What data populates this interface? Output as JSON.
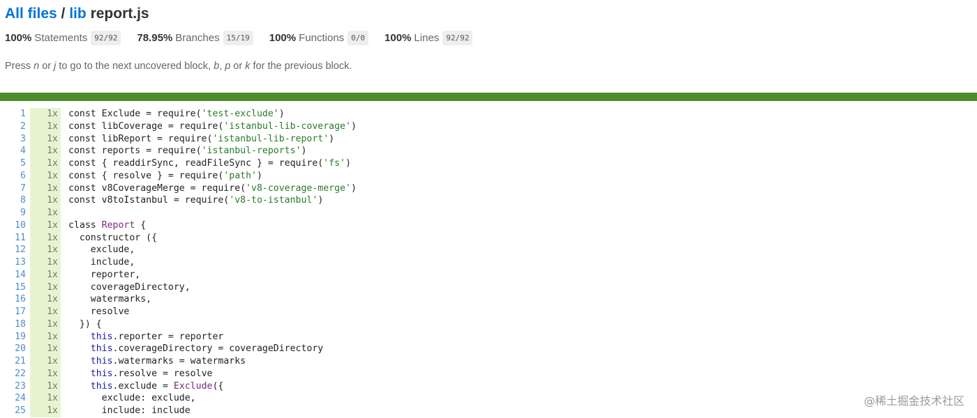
{
  "breadcrumb": {
    "all_files": "All files",
    "sep": " / ",
    "dir": "lib",
    "file": "report.js"
  },
  "summary": [
    {
      "pct": "100%",
      "label": "Statements",
      "frac": "92/92"
    },
    {
      "pct": "78.95%",
      "label": "Branches",
      "frac": "15/19"
    },
    {
      "pct": "100%",
      "label": "Functions",
      "frac": "0/0"
    },
    {
      "pct": "100%",
      "label": "Lines",
      "frac": "92/92"
    }
  ],
  "hint": {
    "p1": "Press ",
    "k1": "n",
    "p2": " or ",
    "k2": "j",
    "p3": " to go to the next uncovered block, ",
    "k3": "b",
    "p4": ", ",
    "k4": "p",
    "p5": " or ",
    "k5": "k",
    "p6": " for the previous block."
  },
  "status_color": "#4d8c2a",
  "lines": [
    {
      "n": "1",
      "hits": "1x",
      "code": [
        [
          "kw",
          "const "
        ],
        [
          "",
          "Exclude = require("
        ],
        [
          "str",
          "'test-exclude'"
        ],
        [
          "",
          ")"
        ]
      ]
    },
    {
      "n": "2",
      "hits": "1x",
      "code": [
        [
          "kw",
          "const "
        ],
        [
          "",
          "libCoverage = require("
        ],
        [
          "str",
          "'istanbul-lib-coverage'"
        ],
        [
          "",
          ")"
        ]
      ]
    },
    {
      "n": "3",
      "hits": "1x",
      "code": [
        [
          "kw",
          "const "
        ],
        [
          "",
          "libReport = require("
        ],
        [
          "str",
          "'istanbul-lib-report'"
        ],
        [
          "",
          ")"
        ]
      ]
    },
    {
      "n": "4",
      "hits": "1x",
      "code": [
        [
          "kw",
          "const "
        ],
        [
          "",
          "reports = require("
        ],
        [
          "str",
          "'istanbul-reports'"
        ],
        [
          "",
          ")"
        ]
      ]
    },
    {
      "n": "5",
      "hits": "1x",
      "code": [
        [
          "kw",
          "const "
        ],
        [
          "",
          "{ readdirSync, readFileSync } = require("
        ],
        [
          "str",
          "'fs'"
        ],
        [
          "",
          ")"
        ]
      ]
    },
    {
      "n": "6",
      "hits": "1x",
      "code": [
        [
          "kw",
          "const "
        ],
        [
          "",
          "{ resolve } = require("
        ],
        [
          "str",
          "'path'"
        ],
        [
          "",
          ")"
        ]
      ]
    },
    {
      "n": "7",
      "hits": "1x",
      "code": [
        [
          "kw",
          "const "
        ],
        [
          "",
          "v8CoverageMerge = require("
        ],
        [
          "str",
          "'v8-coverage-merge'"
        ],
        [
          "",
          ")"
        ]
      ]
    },
    {
      "n": "8",
      "hits": "1x",
      "code": [
        [
          "kw",
          "const "
        ],
        [
          "",
          "v8toIstanbul = require("
        ],
        [
          "str",
          "'v8-to-istanbul'"
        ],
        [
          "",
          ")"
        ]
      ]
    },
    {
      "n": "9",
      "hits": "1x",
      "code": []
    },
    {
      "n": "10",
      "hits": "1x",
      "code": [
        [
          "kw",
          "class "
        ],
        [
          "cls",
          "Report"
        ],
        [
          "",
          " {"
        ]
      ]
    },
    {
      "n": "11",
      "hits": "1x",
      "code": [
        [
          "",
          "  constructor ({"
        ]
      ]
    },
    {
      "n": "12",
      "hits": "1x",
      "code": [
        [
          "",
          "    exclude,"
        ]
      ]
    },
    {
      "n": "13",
      "hits": "1x",
      "code": [
        [
          "",
          "    include,"
        ]
      ]
    },
    {
      "n": "14",
      "hits": "1x",
      "code": [
        [
          "",
          "    reporter,"
        ]
      ]
    },
    {
      "n": "15",
      "hits": "1x",
      "code": [
        [
          "",
          "    coverageDirectory,"
        ]
      ]
    },
    {
      "n": "16",
      "hits": "1x",
      "code": [
        [
          "",
          "    watermarks,"
        ]
      ]
    },
    {
      "n": "17",
      "hits": "1x",
      "code": [
        [
          "",
          "    resolve"
        ]
      ]
    },
    {
      "n": "18",
      "hits": "1x",
      "code": [
        [
          "",
          "  }) {"
        ]
      ]
    },
    {
      "n": "19",
      "hits": "1x",
      "code": [
        [
          "",
          "    "
        ],
        [
          "th",
          "this"
        ],
        [
          "",
          ".reporter = reporter"
        ]
      ]
    },
    {
      "n": "20",
      "hits": "1x",
      "code": [
        [
          "",
          "    "
        ],
        [
          "th",
          "this"
        ],
        [
          "",
          ".coverageDirectory = coverageDirectory"
        ]
      ]
    },
    {
      "n": "21",
      "hits": "1x",
      "code": [
        [
          "",
          "    "
        ],
        [
          "th",
          "this"
        ],
        [
          "",
          ".watermarks = watermarks"
        ]
      ]
    },
    {
      "n": "22",
      "hits": "1x",
      "code": [
        [
          "",
          "    "
        ],
        [
          "th",
          "this"
        ],
        [
          "",
          ".resolve = resolve"
        ]
      ]
    },
    {
      "n": "23",
      "hits": "1x",
      "code": [
        [
          "",
          "    "
        ],
        [
          "th",
          "this"
        ],
        [
          "",
          ".exclude = "
        ],
        [
          "cls",
          "Exclude"
        ],
        [
          "",
          "({"
        ]
      ]
    },
    {
      "n": "24",
      "hits": "1x",
      "code": [
        [
          "",
          "      exclude: exclude,"
        ]
      ]
    },
    {
      "n": "25",
      "hits": "1x",
      "code": [
        [
          "",
          "      include: include"
        ]
      ]
    }
  ],
  "watermark": "@稀土掘金技术社区"
}
